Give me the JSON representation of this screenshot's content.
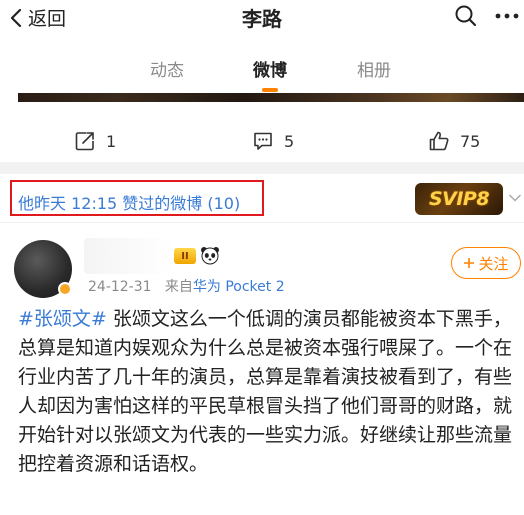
{
  "header": {
    "back_label": "返回",
    "title": "李路"
  },
  "tabs": [
    {
      "label": "动态",
      "active": false
    },
    {
      "label": "微博",
      "active": true
    },
    {
      "label": "相册",
      "active": false
    }
  ],
  "actions": {
    "repost_count": "1",
    "comment_count": "5",
    "like_count": "75"
  },
  "liked_section": {
    "text": "他昨天 12:15 赞过的微博 (10)",
    "badge_text": "SVIP8"
  },
  "post": {
    "level_badge": "II",
    "date": "24-12-31",
    "source_prefix": "来自",
    "source": "华为 Pocket 2",
    "follow_label": "关注",
    "hashtag": "#张颂文#",
    "text": " 张颂文这么一个低调的演员都能被资本下黑手，总算是知道内娱观众为什么总是被资本强行喂屎了。一个在行业内苦了几十年的演员，总算是靠着演技被看到了，有些人却因为害怕这样的平民草根冒头挡了他们哥哥的财路，就开始针对以张颂文为代表的一些实力派。好继续让那些流量把控着资源和话语权。"
  },
  "colors": {
    "accent": "#ff8200",
    "link": "#3a7bd5",
    "highlight_box": "#e0191d"
  }
}
